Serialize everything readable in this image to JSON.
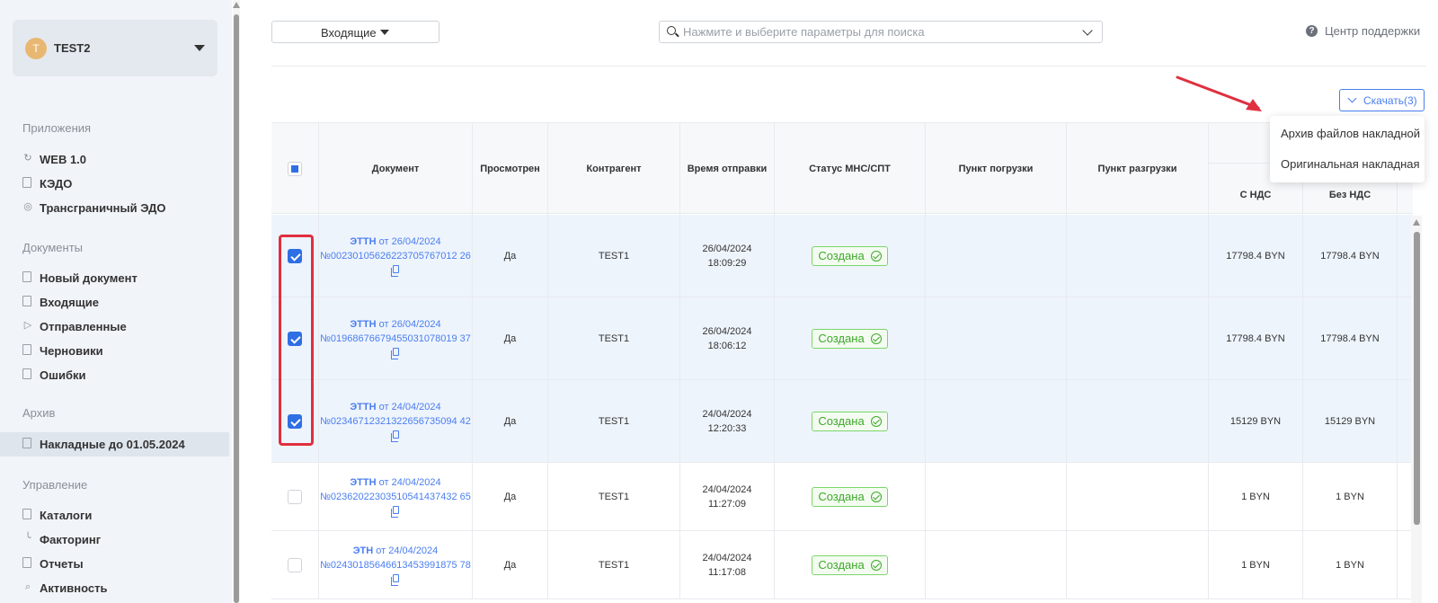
{
  "account": {
    "initial": "T",
    "name": "TEST2"
  },
  "sidebar": {
    "sections": [
      {
        "title": "Приложения",
        "items": [
          {
            "label": "WEB 1.0",
            "icon": "refresh-icon"
          },
          {
            "label": "КЭДО",
            "icon": "document-icon"
          },
          {
            "label": "Трансграничный ЭДО",
            "icon": "globe-icon"
          }
        ]
      },
      {
        "title": "Документы",
        "items": [
          {
            "label": "Новый документ",
            "icon": "new-document-icon"
          },
          {
            "label": "Входящие",
            "icon": "inbox-icon"
          },
          {
            "label": "Отправленные",
            "icon": "send-icon"
          },
          {
            "label": "Черновики",
            "icon": "draft-icon"
          },
          {
            "label": "Ошибки",
            "icon": "error-document-icon"
          }
        ]
      },
      {
        "title": "Архив",
        "items": [
          {
            "label": "Накладные до 01.05.2024",
            "icon": "archive-icon",
            "active": true
          }
        ]
      },
      {
        "title": "Управление",
        "items": [
          {
            "label": "Каталоги",
            "icon": "catalog-icon"
          },
          {
            "label": "Факторинг",
            "icon": "chart-icon"
          },
          {
            "label": "Отчеты",
            "icon": "report-icon"
          },
          {
            "label": "Активность",
            "icon": "search-icon"
          }
        ]
      }
    ]
  },
  "toolbar": {
    "folder": "Входящие",
    "search_placeholder": "Нажмите и выберите параметры для поиска",
    "support": "Центр поддержки",
    "support_icon": "?",
    "download": "Скачать(3)"
  },
  "download_menu": [
    "Архив файлов накладной",
    "Оригинальная накладная"
  ],
  "table": {
    "headers": {
      "document": "Документ",
      "viewed": "Просмотрен",
      "counterparty": "Контрагент",
      "sent_time": "Время отправки",
      "status": "Статус МНС/СПТ",
      "loading": "Пункт погрузки",
      "unloading": "Пункт разгрузки",
      "with_vat": "С НДС",
      "without_vat": "Без НДС"
    },
    "rows": [
      {
        "selected": true,
        "type": "ЭТТН",
        "date": "от 26/04/2024",
        "number": "№00230105626223705767012 26",
        "viewed": "Да",
        "counterparty": "TEST1",
        "date_sent": "26/04/2024",
        "time_sent": "18:09:29",
        "status": "Создана",
        "with_vat": "17798.4 BYN",
        "without_vat": "17798.4 BYN"
      },
      {
        "selected": true,
        "type": "ЭТТН",
        "date": "от 26/04/2024",
        "number": "№01968676679455031078019 37",
        "viewed": "Да",
        "counterparty": "TEST1",
        "date_sent": "26/04/2024",
        "time_sent": "18:06:12",
        "status": "Создана",
        "with_vat": "17798.4 BYN",
        "without_vat": "17798.4 BYN"
      },
      {
        "selected": true,
        "type": "ЭТТН",
        "date": "от 24/04/2024",
        "number": "№02346712321322656735094 42",
        "viewed": "Да",
        "counterparty": "TEST1",
        "date_sent": "24/04/2024",
        "time_sent": "12:20:33",
        "status": "Создана",
        "with_vat": "15129 BYN",
        "without_vat": "15129 BYN"
      },
      {
        "selected": false,
        "type": "ЭТТН",
        "date": "от 24/04/2024",
        "number": "№02362022303510541437432 65",
        "viewed": "Да",
        "counterparty": "TEST1",
        "date_sent": "24/04/2024",
        "time_sent": "11:27:09",
        "status": "Создана",
        "with_vat": "1 BYN",
        "without_vat": "1 BYN"
      },
      {
        "selected": false,
        "type": "ЭТН",
        "date": "от 24/04/2024",
        "number": "№02430185646613453991875 78",
        "viewed": "Да",
        "counterparty": "TEST1",
        "date_sent": "24/04/2024",
        "time_sent": "11:17:08",
        "status": "Создана",
        "with_vat": "1 BYN",
        "without_vat": "1 BYN"
      }
    ]
  },
  "colors": {
    "accent": "#2f6fe4",
    "status_green": "#3fa82c",
    "annotation_red": "#e02f3f"
  }
}
